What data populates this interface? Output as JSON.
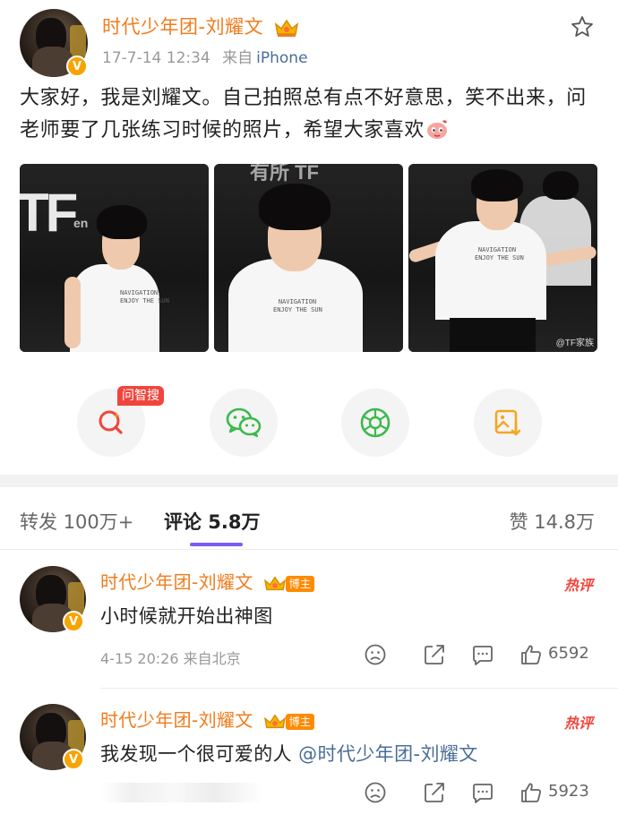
{
  "post": {
    "author": "时代少年团-刘耀文",
    "timestamp": "17-7-14 12:34",
    "source_prefix": "来自",
    "source": "iPhone",
    "text": "大家好，我是刘耀文。自己拍照总有点不好意思，笑不出来，问老师要了几张练习时候的照片，希望大家喜欢",
    "verified_icon": "verified-v-icon",
    "favorite_icon": "star-outline-icon",
    "photos": [
      {
        "shirt_text": "NAVIGATION\nENJOY THE SUN"
      },
      {
        "shirt_text": "NAVIGATION\nENJOY THE SUN"
      },
      {
        "shirt_text": "NAVIGATION\nENJOY THE SUN",
        "watermark": "@TF家族"
      }
    ]
  },
  "actions": {
    "ask_badge": "问智搜",
    "items": [
      {
        "icon": "search-ai-icon"
      },
      {
        "icon": "wechat-icon"
      },
      {
        "icon": "moments-icon"
      },
      {
        "icon": "save-image-icon"
      }
    ]
  },
  "tabs": {
    "repost": "转发 100万+",
    "comment": "评论 5.8万",
    "like": "赞 14.8万"
  },
  "comments": [
    {
      "author": "时代少年团-刘耀文",
      "role_tag": "博主",
      "hot_tag": "热评",
      "text": "小时候就开始出神图",
      "meta": "4-15 20:26 来自北京",
      "likes": "6592"
    },
    {
      "author": "时代少年团-刘耀文",
      "role_tag": "博主",
      "hot_tag": "热评",
      "text_prefix": "我发现一个很可爱的人 ",
      "mention": "@时代少年团-刘耀文",
      "likes": "5923"
    }
  ],
  "colors": {
    "username": "#f07c1d",
    "link": "#4a6d9a",
    "accent_underline": "#7a5cf2",
    "hot": "#f2463d",
    "badge_red": "#f0453c"
  }
}
